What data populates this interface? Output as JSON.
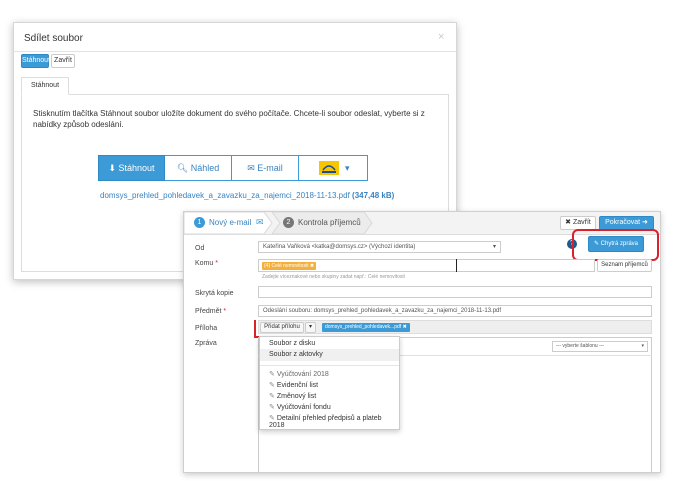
{
  "dialog1": {
    "title": "Sdílet soubor",
    "close_x": "×",
    "toolbar": {
      "stahnout": "Stáhnout",
      "zavrit": "Zavřít"
    },
    "tab_label": "Stáhnout",
    "info_text": "Stisknutím tlačítka Stáhnout soubor uložíte dokument do svého počítače. Chcete-li soubor odeslat, vyberte si z nabídky způsob odeslání.",
    "buttons": {
      "stahnout": "Stáhnout",
      "nahled": "Náhled",
      "email": "E-mail",
      "caret": "▾"
    },
    "file_name": "domsys_prehled_pohledavek_a_zavazku_za_najemci_2018-11-13.pdf",
    "file_size": "(347,48 kB)"
  },
  "dialog2": {
    "steps": {
      "step1_num": "1",
      "step1": "Nový e-mail",
      "step2_num": "2",
      "step2": "Kontrola příjemců"
    },
    "zavrit": "Zavřít",
    "pokracovat": "Pokračovat",
    "help": "?",
    "chytra_zprava": "Chytrá zpráva",
    "labels": {
      "od": "Od",
      "komu": "Komu",
      "required": "*",
      "skryta": "Skrytá kopie",
      "predmet": "Předmět",
      "priloha": "Příloha",
      "zprava": "Zpráva"
    },
    "od_value": "Kateřina Vaňková <katka@domsys.cz> (Výchozí identita)",
    "od_caret": "▾",
    "komu_tag": "(4) Celé nemovitosti",
    "komu_hint": "Zadejte víceznakové nebo skupiny zadat např.: Celé nemovitosti",
    "seznam": "Seznam příjemců",
    "predmet_value": "Odeslání souboru: domsys_prehled_pohledavek_a_zavazku_za_najemci_2018-11-13.pdf",
    "pridat_prilohu": "Přidat přílohu",
    "priloha_caret": "▾",
    "priloha_tag": "domsys_prehled_pohledavek...pdf",
    "sablona": "--- vyberte šablonu ---",
    "sablona_caret": "▾"
  },
  "dropdown": {
    "items": [
      "Soubor z disku",
      "Soubor z aktovky"
    ],
    "templates": [
      "Vyúčtování 2018",
      "Evidenční list",
      "Změnový list",
      "Vyúčtování fondu",
      "Detailní přehled předpisů a plateb 2018"
    ]
  },
  "colors": {
    "accent": "#3c9ad6",
    "highlight": "#d9222a",
    "tag": "#f4b03c"
  }
}
